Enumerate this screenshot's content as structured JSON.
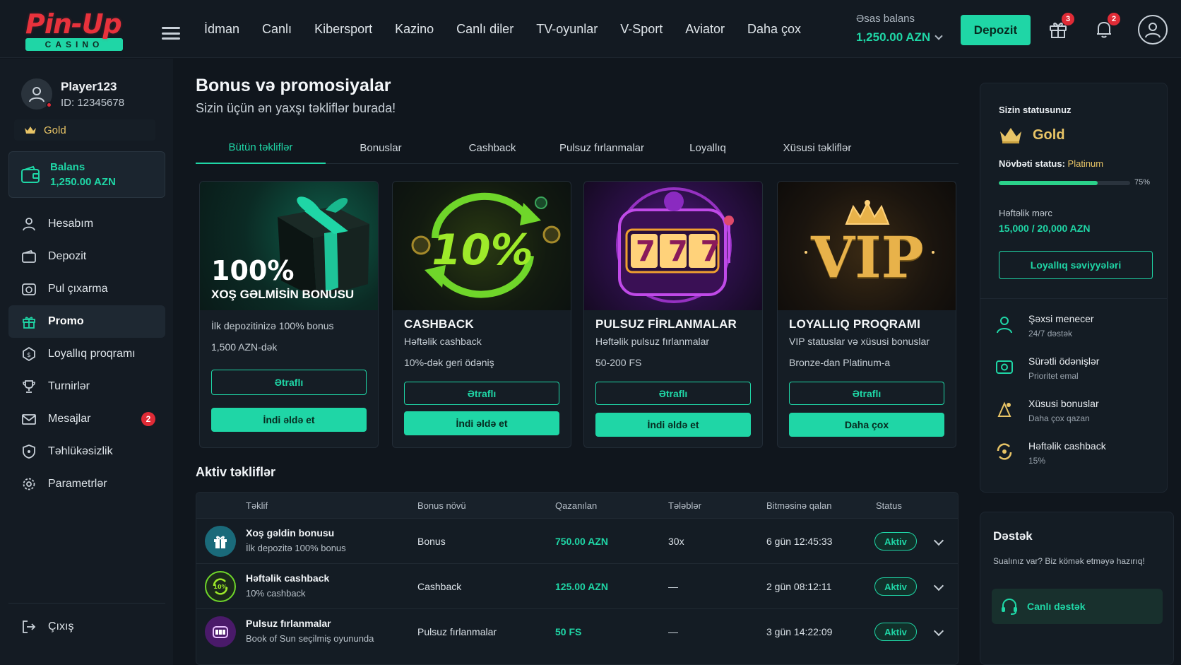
{
  "header": {
    "logo_top": "Pin-Up",
    "logo_bottom": "CASINO",
    "nav": [
      "İdman",
      "Canlı",
      "Kibersport",
      "Kazino",
      "Canlı diler",
      "TV-oyunlar",
      "V-Sport",
      "Aviator",
      "Daha çox"
    ],
    "balance_label": "Əsas balans",
    "balance_value": "1,250.00 AZN",
    "deposit_label": "Depozit",
    "gift_badge": "3",
    "bell_badge": "2"
  },
  "sidebar": {
    "username": "Player123",
    "user_id": "ID: 12345678",
    "level": "Gold",
    "balance_label": "Balans",
    "balance_value": "1,250.00 AZN",
    "items": [
      {
        "label": "Hesabım",
        "icon": "user-icon"
      },
      {
        "label": "Depozit",
        "icon": "wallet-icon"
      },
      {
        "label": "Pul çıxarma",
        "icon": "withdraw-icon"
      },
      {
        "label": "Promo",
        "icon": "gift-icon",
        "active": true
      },
      {
        "label": "Loyallıq proqramı",
        "icon": "loyalty-icon"
      },
      {
        "label": "Turnirlər",
        "icon": "trophy-icon"
      },
      {
        "label": "Mesajlar",
        "icon": "mail-icon",
        "count": "2"
      },
      {
        "label": "Təhlükəsizlik",
        "icon": "shield-icon"
      },
      {
        "label": "Parametrlər",
        "icon": "gear-icon"
      }
    ],
    "logout": "Çıxış"
  },
  "main": {
    "title": "Bonus və promosiyalar",
    "subtitle": "Sizin üçün ən yaxşı təkliflər burada!",
    "tabs": [
      "Bütün təkliflər",
      "Bonuslar",
      "Cashback",
      "Pulsuz fırlanmalar",
      "Loyallıq",
      "Xüsusi təkliflər"
    ],
    "cards": [
      {
        "img_big": "100%",
        "img_sub": "XOŞ GƏLMİSİN BONUSU",
        "title": "",
        "desc": "İlk depozitinizə 100% bonus",
        "desc2": "1,500 AZN-dək",
        "btn1": "Ətraflı",
        "btn2": "İndi əldə et"
      },
      {
        "img_big": "10%",
        "img_sub": "",
        "title": "CASHBACK",
        "desc": "Həftəlik cashback",
        "desc2": "10%-dək geri ödəniş",
        "btn1": "Ətraflı",
        "btn2": "İndi əldə et"
      },
      {
        "img_big": "777",
        "img_sub": "",
        "title": "PULSUZ FİRLANMALAR",
        "desc": "Həftəlik pulsuz fırlanmalar",
        "desc2": "50-200 FS",
        "btn1": "Ətraflı",
        "btn2": "İndi əldə et"
      },
      {
        "img_big": "VIP",
        "img_sub": "",
        "title": "LOYALLIQ PROQRAMI",
        "desc": "VIP statuslar və xüsusi bonuslar",
        "desc2": "Bronze-dan Platinum-a",
        "btn1": "Ətraflı",
        "btn2": "Daha çox"
      }
    ],
    "active_title": "Aktiv təkliflər",
    "table_headers": [
      "Təklif",
      "Bonus növü",
      "Qazanılan",
      "Tələblər",
      "Bitməsinə qalan",
      "Status"
    ],
    "rows": [
      {
        "name": "Xoş gəldin bonusu",
        "sub": "İlk depozitə 100% bonus",
        "type": "Bonus",
        "earned": "750.00 AZN",
        "req": "30x",
        "left": "6 gün 12:45:33",
        "status": "Aktiv",
        "icon": "gift-icon"
      },
      {
        "name": "Həftəlik cashback",
        "sub": "10% cashback",
        "type": "Cashback",
        "earned": "125.00 AZN",
        "req": "—",
        "left": "2 gün 08:12:11",
        "status": "Aktiv",
        "icon": "cashback-icon"
      },
      {
        "name": "Pulsuz fırlanmalar",
        "sub": "Book of Sun seçilmiş oyununda",
        "type": "Pulsuz fırlanmalar",
        "earned": "50 FS",
        "req": "—",
        "left": "3 gün 14:22:09",
        "status": "Aktiv",
        "icon": "slot-icon"
      }
    ]
  },
  "right": {
    "status_label": "Sizin statusunuz",
    "status": "Gold",
    "next_label": "Növbəti status:",
    "next_value": "Platinum",
    "progress_pct": 75,
    "progress_text": "75%",
    "weekly_label": "Həftəlik mərc",
    "weekly_value": "15,000 / 20,000 AZN",
    "loyalty_btn": "Loyallıq səviyyələri",
    "perks": [
      {
        "title": "Şəxsi menecer",
        "sub": "24/7 dəstək",
        "icon": "manager-icon"
      },
      {
        "title": "Sürətli ödənişlər",
        "sub": "Prioritet emal",
        "icon": "fast-pay-icon"
      },
      {
        "title": "Xüsusi bonuslar",
        "sub": "Daha çox qazan",
        "icon": "special-bonus-icon"
      },
      {
        "title": "Həftəlik cashback",
        "sub": "15%",
        "icon": "cashback-icon"
      }
    ],
    "support_title": "Dəstək",
    "support_desc": "Sualınız var? Biz kömək etməyə hazırıq!",
    "support_btn": "Canlı dəstək"
  },
  "colors": {
    "accent": "#1fd6a6",
    "gold": "#e8c466",
    "badge": "#e02b36",
    "bg": "#10161d"
  }
}
